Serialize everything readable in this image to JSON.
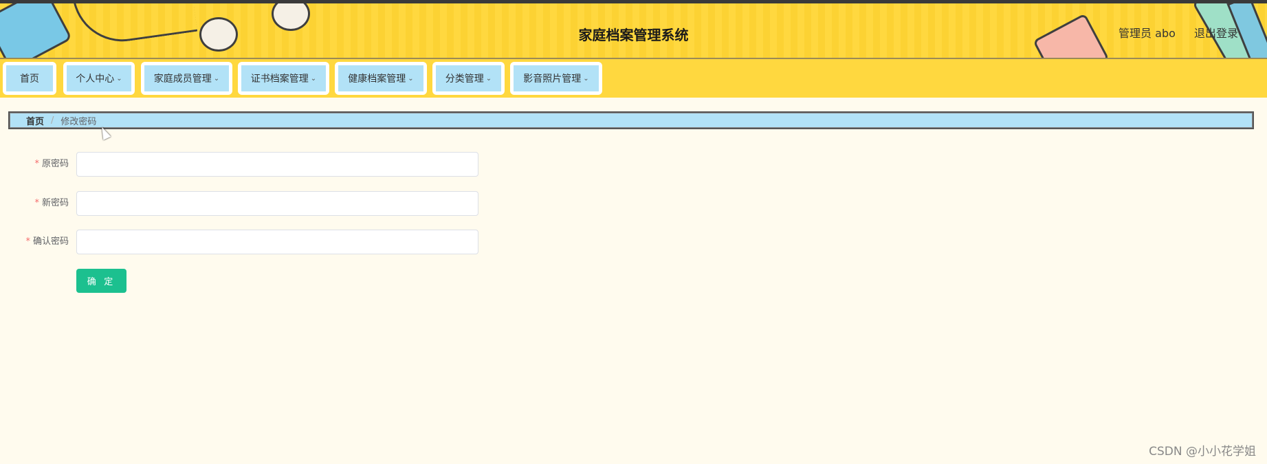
{
  "header": {
    "title": "家庭档案管理系统",
    "user_label": "管理员 abo",
    "logout_label": "退出登录"
  },
  "nav": {
    "items": [
      {
        "label": "首页",
        "dropdown": false
      },
      {
        "label": "个人中心",
        "dropdown": true
      },
      {
        "label": "家庭成员管理",
        "dropdown": true
      },
      {
        "label": "证书档案管理",
        "dropdown": true
      },
      {
        "label": "健康档案管理",
        "dropdown": true
      },
      {
        "label": "分类管理",
        "dropdown": true
      },
      {
        "label": "影音照片管理",
        "dropdown": true
      }
    ]
  },
  "breadcrumb": {
    "home": "首页",
    "separator": "/",
    "current": "修改密码"
  },
  "form": {
    "required_mark": "*",
    "fields": [
      {
        "label": "原密码",
        "value": "",
        "placeholder": ""
      },
      {
        "label": "新密码",
        "value": "",
        "placeholder": ""
      },
      {
        "label": "确认密码",
        "value": "",
        "placeholder": ""
      }
    ],
    "submit_label": "确 定"
  },
  "watermark": "CSDN @小小花学姐",
  "colors": {
    "header_bg": "#ffd83f",
    "nav_item_bg": "#b2e2f7",
    "submit_bg": "#1cc08f",
    "required": "#f56c6c"
  }
}
